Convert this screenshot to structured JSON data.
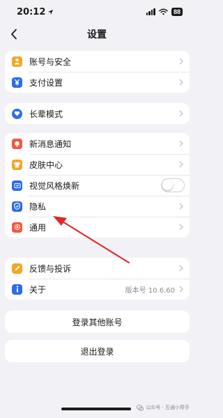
{
  "status_bar": {
    "time": "20:12",
    "battery": "88"
  },
  "nav": {
    "title": "设置"
  },
  "groups": {
    "account": [
      {
        "label": "账号与安全",
        "icon": "person-icon",
        "color": "#f5a623"
      },
      {
        "label": "支付设置",
        "icon": "yuan-icon",
        "color": "#2b6ee8"
      }
    ],
    "elder": [
      {
        "label": "长辈模式",
        "icon": "heart-icon",
        "color": "#2b6ee8"
      }
    ],
    "prefs": [
      {
        "label": "新消息通知",
        "icon": "bell-icon",
        "color": "#f2583e"
      },
      {
        "label": "皮肤中心",
        "icon": "shirt-icon",
        "color": "#f5a623"
      },
      {
        "label": "视觉风格焕新",
        "icon": "new-badge-icon",
        "color": "#2b6ee8",
        "toggle": false
      },
      {
        "label": "隐私",
        "icon": "shield-icon",
        "color": "#2b6ee8"
      },
      {
        "label": "通用",
        "icon": "gear-icon",
        "color": "#f2583e"
      }
    ],
    "about": [
      {
        "label": "反馈与投诉",
        "icon": "pencil-icon",
        "color": "#f5a623"
      },
      {
        "label": "关于",
        "icon": "info-icon",
        "color": "#2b6ee8",
        "value": "版本号 10.6.60"
      }
    ]
  },
  "buttons": {
    "switch_account": "登录其他账号",
    "logout": "退出登录"
  },
  "watermark": {
    "text": "公众号 · 互通小帮手"
  },
  "colors": {
    "background": "#f2f2f6",
    "arrow": "#e02a2a"
  }
}
